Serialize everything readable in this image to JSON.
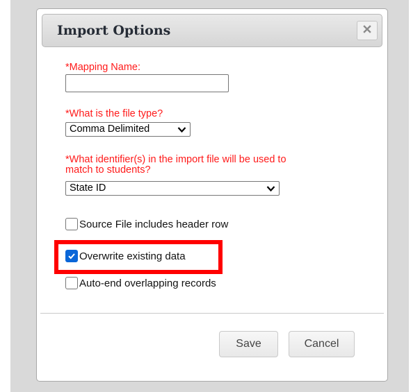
{
  "dialog": {
    "title": "Import Options",
    "close_icon": "close-icon"
  },
  "form": {
    "mapping_name_label": "*Mapping Name:",
    "mapping_name_value": "",
    "file_type_label": "*What is the file type?",
    "file_type_value": "Comma Delimited",
    "identifier_label_line1": "*What identifier(s) in the import file will be used to",
    "identifier_label_line2": "match to students?",
    "identifier_value": "State ID"
  },
  "checkboxes": [
    {
      "label": "Source File includes header row",
      "checked": false
    },
    {
      "label": "Overwrite existing data",
      "checked": true
    },
    {
      "label": "Auto-end overlapping records",
      "checked": false
    }
  ],
  "buttons": {
    "save_label": "Save",
    "cancel_label": "Cancel"
  },
  "colors": {
    "required_label": "#ff1a1a",
    "highlight": "#ff0000",
    "checkbox_checked": "#0a66d8",
    "overlay": "#d9d9d9"
  }
}
